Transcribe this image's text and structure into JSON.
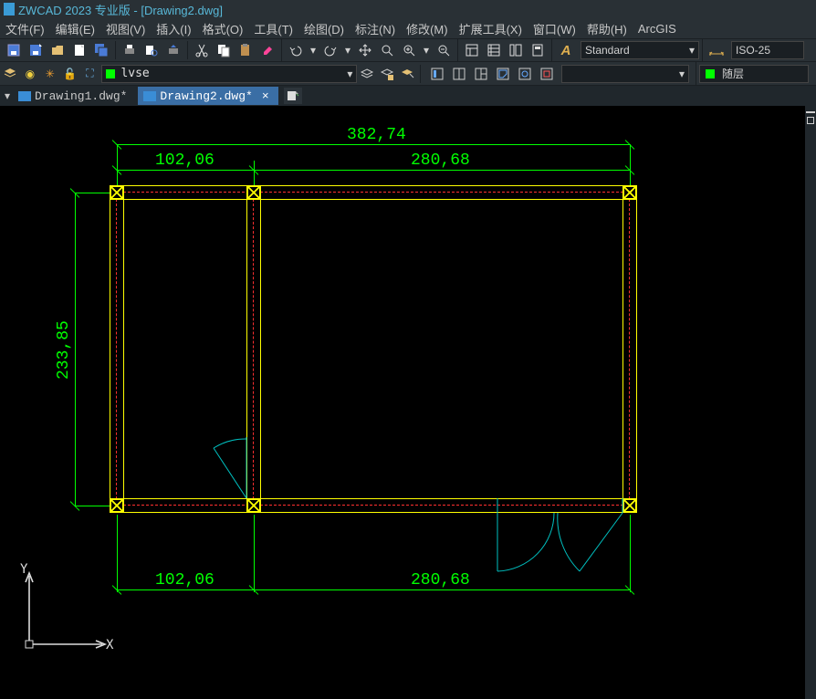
{
  "title": "ZWCAD 2023 专业版 - [Drawing2.dwg]",
  "menu": [
    "文件(F)",
    "编辑(E)",
    "视图(V)",
    "插入(I)",
    "格式(O)",
    "工具(T)",
    "绘图(D)",
    "标注(N)",
    "修改(M)",
    "扩展工具(X)",
    "窗口(W)",
    "帮助(H)",
    "ArcGIS"
  ],
  "toolbar1": {
    "text_style_label": "Standard",
    "dim_style_label": "ISO-25"
  },
  "layer": {
    "current_name": "lvse",
    "color": "#00ff00",
    "linetype_label": "随层"
  },
  "tabs": [
    {
      "label": "Drawing1.dwg*",
      "active": false
    },
    {
      "label": "Drawing2.dwg*",
      "active": true
    }
  ],
  "drawing": {
    "dims": {
      "total_top": "382,74",
      "left_top": "102,06",
      "right_top": "280,68",
      "left_vert": "233,85",
      "left_bottom": "102,06",
      "right_bottom": "280,68"
    },
    "ucs": {
      "x_label": "X",
      "y_label": "Y"
    }
  }
}
